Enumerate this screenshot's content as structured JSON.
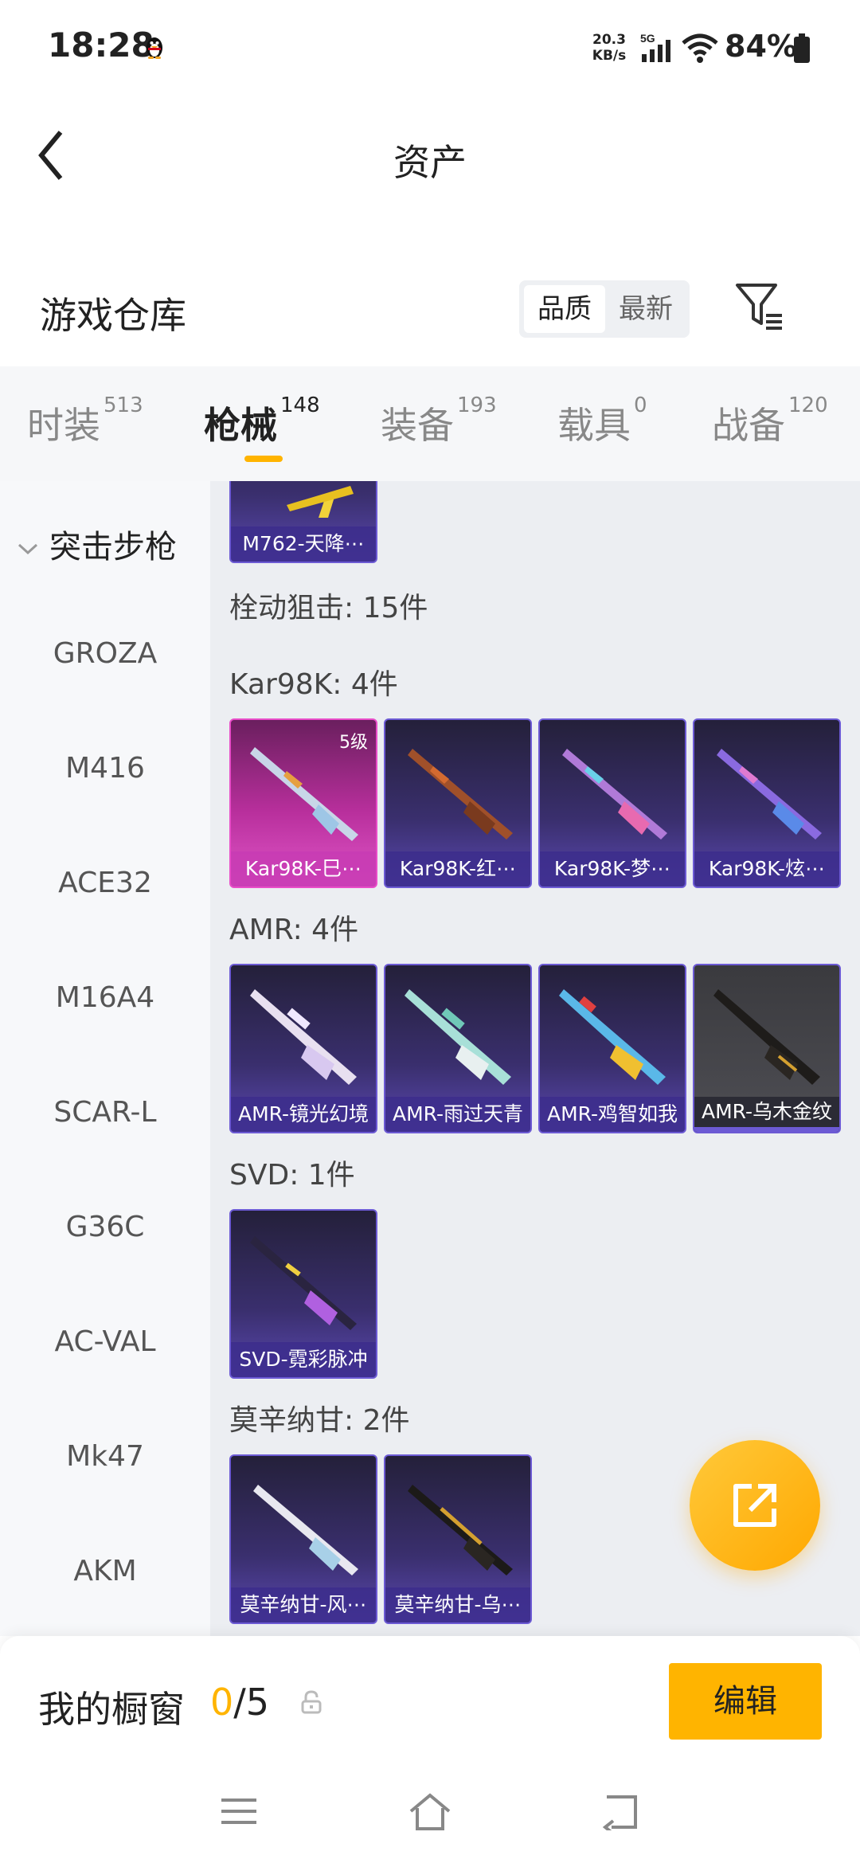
{
  "status_bar": {
    "time": "18:28",
    "net_speed_value": "20.3",
    "net_speed_unit": "KB/s",
    "network": "5G",
    "battery": "84%",
    "icons": [
      "qq-penguin-icon",
      "signal-icon",
      "wifi-icon",
      "battery-icon"
    ]
  },
  "header": {
    "title": "资产",
    "back_icon": "chevron-left-icon"
  },
  "warehouse": {
    "title": "游戏仓库",
    "sort_options": [
      "品质",
      "最新"
    ],
    "sort_selected": "品质",
    "filter_icon": "filter-icon"
  },
  "tabs": [
    {
      "label": "时装",
      "count": "513"
    },
    {
      "label": "枪械",
      "count": "148",
      "active": true
    },
    {
      "label": "装备",
      "count": "193"
    },
    {
      "label": "载具",
      "count": "0"
    },
    {
      "label": "战备",
      "count": "120"
    }
  ],
  "sidebar": {
    "category": "突击步枪",
    "items": [
      "GROZA",
      "M416",
      "ACE32",
      "M16A4",
      "SCAR-L",
      "G36C",
      "AC-VAL",
      "Mk47",
      "AKM"
    ]
  },
  "content": {
    "top_partial_card": "M762-天降⋯",
    "section_title": "栓动狙击: 15件",
    "groups": [
      {
        "label": "Kar98K: 4件",
        "items": [
          {
            "name": "Kar98K-巳⋯",
            "level": "5级",
            "style": "pink"
          },
          {
            "name": "Kar98K-红⋯",
            "style": "purple"
          },
          {
            "name": "Kar98K-梦⋯",
            "style": "purple"
          },
          {
            "name": "Kar98K-炫⋯",
            "style": "purple"
          }
        ]
      },
      {
        "label": "AMR: 4件",
        "items": [
          {
            "name": "AMR-镜光幻境",
            "style": "purple"
          },
          {
            "name": "AMR-雨过天青",
            "style": "purple"
          },
          {
            "name": "AMR-鸡智如我",
            "style": "purple"
          },
          {
            "name": "AMR-乌木金纹",
            "style": "grey"
          }
        ]
      },
      {
        "label": "SVD: 1件",
        "items": [
          {
            "name": "SVD-霓彩脉冲",
            "style": "purple"
          }
        ]
      },
      {
        "label": "莫辛纳甘: 2件",
        "items": [
          {
            "name": "莫辛纳甘-风⋯",
            "style": "purple"
          },
          {
            "name": "莫辛纳甘-乌⋯",
            "style": "purple"
          }
        ]
      }
    ]
  },
  "share_button": {
    "icon": "share-external-icon"
  },
  "showcase": {
    "label": "我的橱窗",
    "current": "0",
    "total": "/5",
    "lock_icon": "lock-icon",
    "edit_label": "编辑"
  },
  "nav_bar": {
    "icons": [
      "menu-icon",
      "home-icon",
      "back-nav-icon"
    ]
  },
  "colors": {
    "accent": "#ffb400",
    "card_purple": "#5a48b0",
    "card_pink": "#e055c8",
    "content_bg": "#eceef2"
  }
}
